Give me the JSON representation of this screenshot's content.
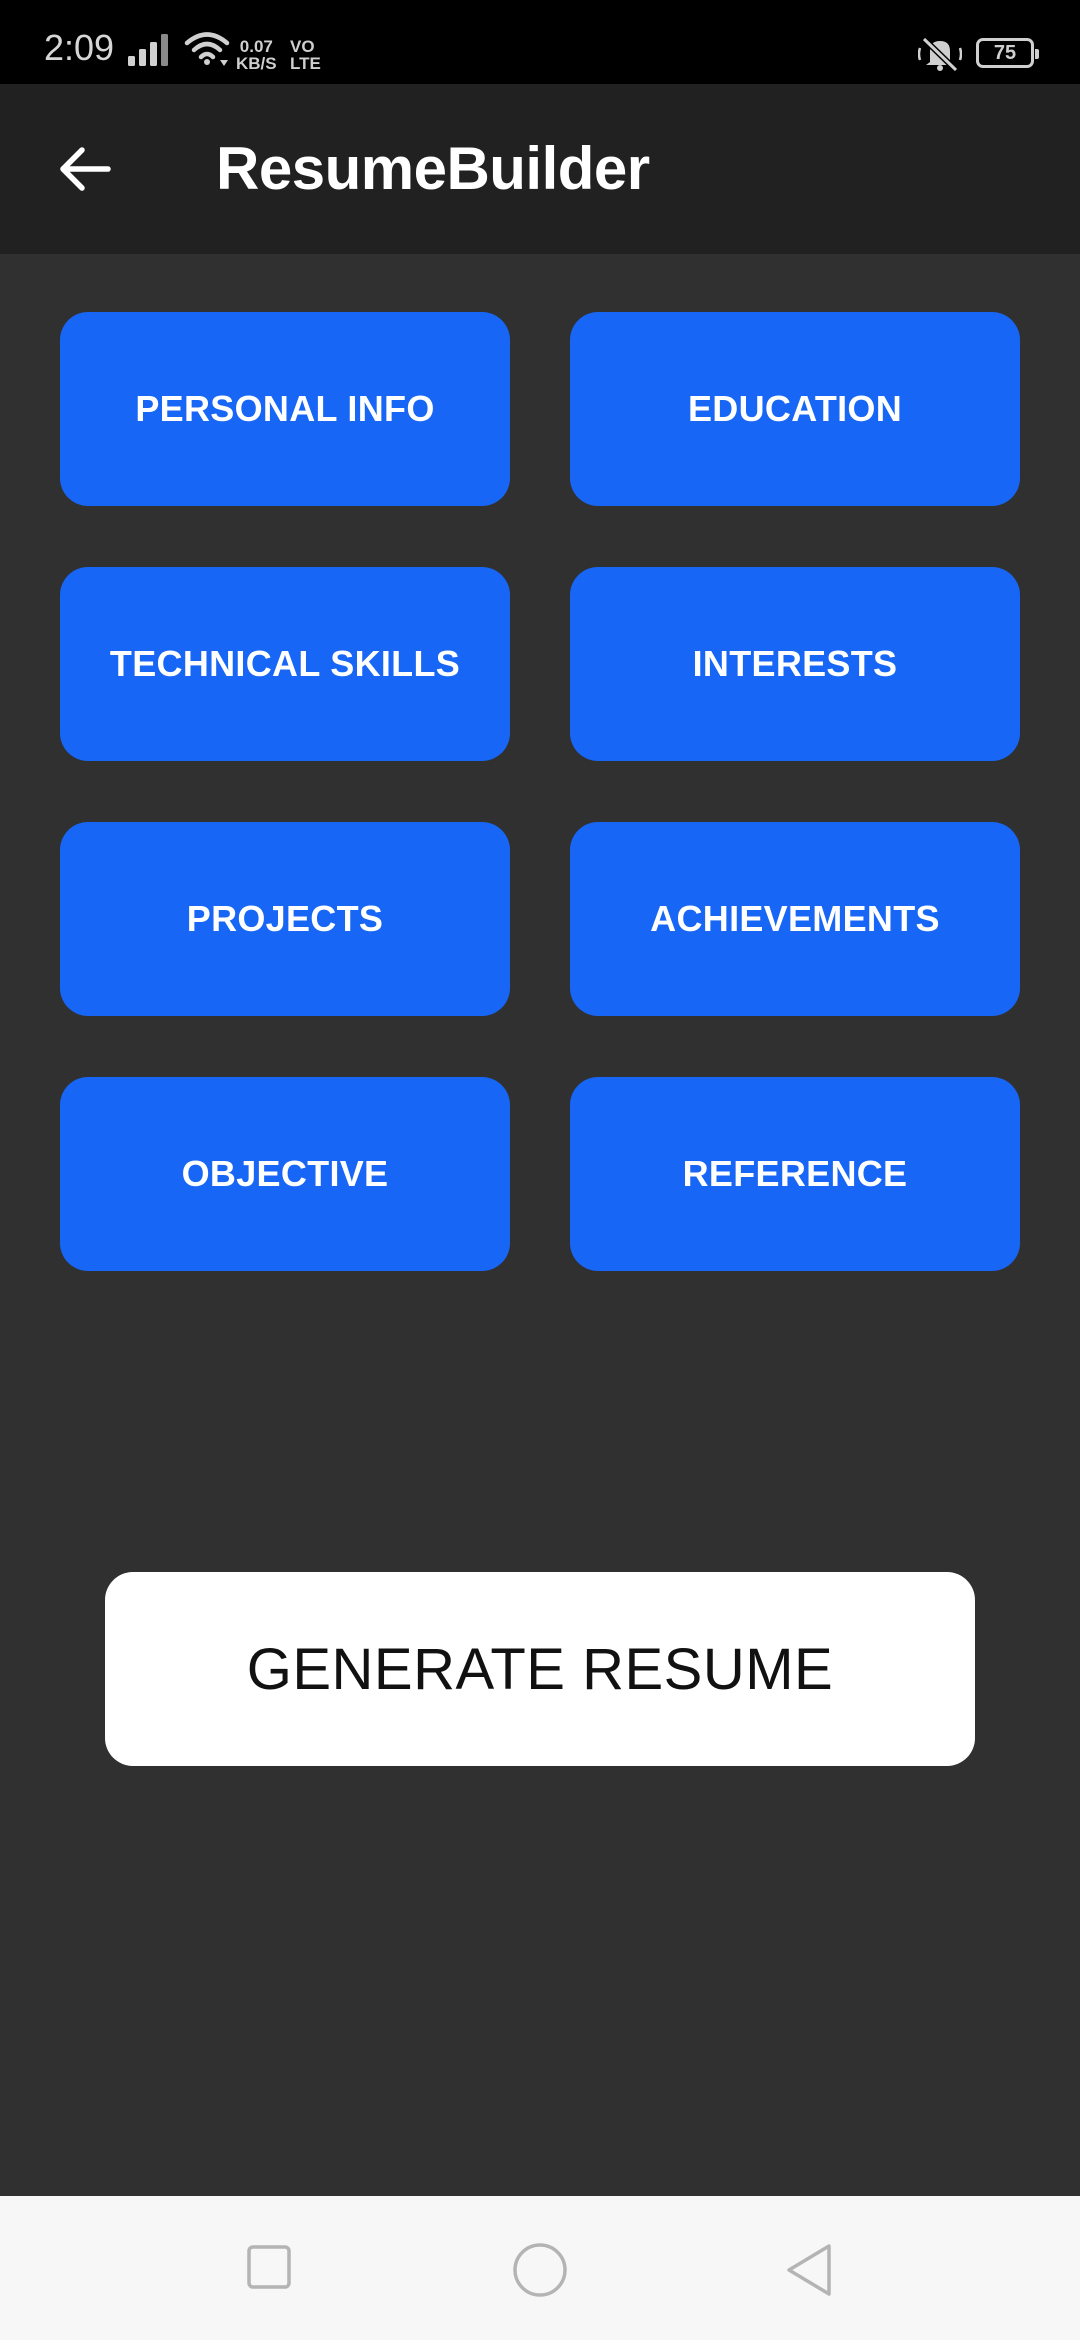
{
  "status_bar": {
    "time": "2:09",
    "speed_value": "0.07",
    "speed_unit": "KB/S",
    "network_top": "VO",
    "network_bottom": "LTE",
    "battery": "75",
    "icons": [
      "signal-icon",
      "wifi-icon",
      "mute-icon",
      "battery-icon"
    ]
  },
  "app_bar": {
    "title": "ResumeBuilder",
    "back_icon": "arrow-left-icon"
  },
  "sections": {
    "personal_info": "PERSONAL INFO",
    "education": "EDUCATION",
    "technical_skills": "TECHNICAL SKILLS",
    "interests": "INTERESTS",
    "projects": "PROJECTS",
    "achievements": "ACHIEVEMENTS",
    "objective": "OBJECTIVE",
    "reference": "REFERENCE"
  },
  "generate_button": "GENERATE RESUME",
  "nav_bar": {
    "icons": [
      "recent-apps-icon",
      "home-icon",
      "back-icon"
    ]
  },
  "colors": {
    "background": "#303030",
    "app_bar": "#212121",
    "accent": "#1766f5",
    "generate_bg": "#ffffff"
  }
}
